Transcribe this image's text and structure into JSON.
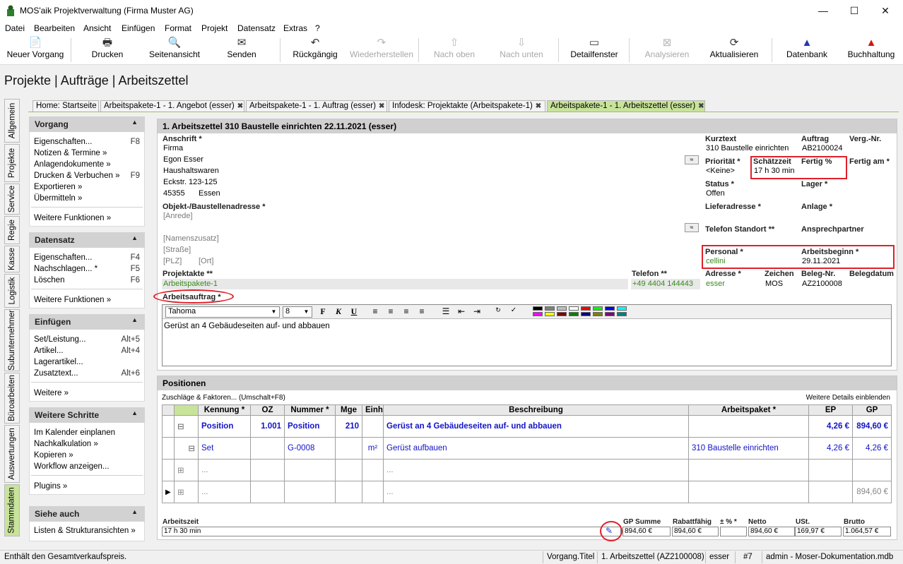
{
  "window": {
    "title": "MOS'aik Projektverwaltung (Firma Muster AG)",
    "minimize": "—",
    "maximize": "☐",
    "close": "✕"
  },
  "menu": [
    "Datei",
    "Bearbeiten",
    "Ansicht",
    "Einfügen",
    "Format",
    "Projekt",
    "Datensatz",
    "Extras",
    "?"
  ],
  "toolbar": [
    {
      "label": "Neuer Vorgang",
      "icon": "📄"
    },
    {
      "label": "Drucken",
      "icon": "🖶"
    },
    {
      "label": "Seitenansicht",
      "icon": "🔍"
    },
    {
      "label": "Senden",
      "icon": "✉"
    },
    {
      "label": "Rückgängig",
      "icon": "↶"
    },
    {
      "label": "Wiederherstellen",
      "icon": "↷"
    },
    {
      "label": "Nach oben",
      "icon": "⇧"
    },
    {
      "label": "Nach unten",
      "icon": "⇩"
    },
    {
      "label": "Detailfenster",
      "icon": "▭"
    },
    {
      "label": "Analysieren",
      "icon": "⊠"
    },
    {
      "label": "Aktualisieren",
      "icon": "⟳"
    },
    {
      "label": "Datenbank",
      "icon": "▲"
    },
    {
      "label": "Buchhaltung",
      "icon": "▲"
    }
  ],
  "breadcrumb": "Projekte | Aufträge | Arbeitszettel",
  "side_tabs": [
    "Allgemein",
    "Projekte",
    "Service",
    "Regie",
    "Kasse",
    "Logistik",
    "Subunternehmer",
    "Büroarbeiten",
    "Auswertungen",
    "Stammdaten"
  ],
  "doc_tabs": [
    "Home: Startseite",
    "Arbeitspakete-1 - 1. Angebot (esser)",
    "Arbeitspakete-1 - 1. Auftrag (esser)",
    "Infodesk: Projektakte (Arbeitspakete-1)",
    "Arbeitspakete-1 - 1. Arbeitszettel (esser)"
  ],
  "tab_close": "✖",
  "left_panel": {
    "vorgang": {
      "title": "Vorgang",
      "items": [
        {
          "label": "Eigenschaften...",
          "key": "F8"
        },
        {
          "label": "Notizen & Termine »",
          "key": ""
        },
        {
          "label": "Anlagendokumente »",
          "key": ""
        },
        {
          "label": "Drucken & Verbuchen »",
          "key": "F9"
        },
        {
          "label": "Exportieren »",
          "key": ""
        },
        {
          "label": "Übermitteln »",
          "key": ""
        }
      ],
      "more": "Weitere Funktionen »"
    },
    "datensatz": {
      "title": "Datensatz",
      "items": [
        {
          "label": "Eigenschaften...",
          "key": "F4"
        },
        {
          "label": "Nachschlagen... *",
          "key": "F5"
        },
        {
          "label": "Löschen",
          "key": "F6"
        }
      ],
      "more": "Weitere Funktionen »"
    },
    "einfuegen": {
      "title": "Einfügen",
      "items": [
        {
          "label": "Set/Leistung...",
          "key": "Alt+5"
        },
        {
          "label": "Artikel...",
          "key": "Alt+4"
        },
        {
          "label": "Lagerartikel...",
          "key": ""
        },
        {
          "label": "Zusatztext...",
          "key": "Alt+6"
        }
      ],
      "more": "Weitere »"
    },
    "schritte": {
      "title": "Weitere Schritte",
      "items": [
        {
          "label": "Im Kalender einplanen",
          "key": ""
        },
        {
          "label": "Nachkalkulation »",
          "key": ""
        },
        {
          "label": "Kopieren »",
          "key": ""
        },
        {
          "label": "Workflow anzeigen...",
          "key": ""
        }
      ],
      "more": "Plugins »"
    },
    "siehe": {
      "title": "Siehe auch",
      "items": [
        {
          "label": "Listen & Strukturansichten »",
          "key": ""
        }
      ]
    }
  },
  "form": {
    "header": "1. Arbeitszettel 310 Baustelle einrichten 22.11.2021 (esser)",
    "anschrift_label": "Anschrift *",
    "anschrift": [
      "Firma",
      "Egon Esser",
      "Haushaltswaren",
      "Eckstr. 123-125"
    ],
    "plz": "45355",
    "ort": "Essen",
    "objekt_label": "Objekt-/Baustellenadresse *",
    "objekt_placeholders": {
      "anrede": "[Anrede]",
      "namenszusatz": "[Namenszusatz]",
      "strasse": "[Straße]",
      "plz": "[PLZ]",
      "ort": "[Ort]"
    },
    "projektakte_label": "Projektakte **",
    "projektakte": "Arbeitspakete-1",
    "telefon_label": "Telefon **",
    "telefon": "+49 4404 144443",
    "adresse_label": "Adresse *",
    "adresse": "esser",
    "zeichen_label": "Zeichen",
    "zeichen": "MOS",
    "belegnr_label": "Beleg-Nr.",
    "belegnr": "AZ2100008",
    "belegdatum_label": "Belegdatum",
    "belegdatum": "",
    "kurztext_label": "Kurztext",
    "kurztext": "310 Baustelle einrichten",
    "auftrag_label": "Auftrag",
    "auftrag": "AB2100024",
    "vergnr_label": "Verg.-Nr.",
    "vergnr": "",
    "prioritaet_label": "Priorität *",
    "prioritaet": "<Keine>",
    "schaetzzeit_label": "Schätzzeit",
    "schaetzzeit": "17 h 30 min",
    "fertig_label": "Fertig %",
    "fertig": "",
    "fertigam_label": "Fertig am *",
    "fertigam": "",
    "status_label": "Status *",
    "status": "Offen",
    "lager_label": "Lager *",
    "lager": "",
    "lieferadresse_label": "Lieferadresse *",
    "lieferadresse": "",
    "anlage_label": "Anlage *",
    "anlage": "",
    "telstandort_label": "Telefon Standort **",
    "telstandort": "",
    "ansprech_label": "Ansprechpartner",
    "ansprech": "",
    "personal_label": "Personal *",
    "personal": "cellini",
    "arbeitsbeginn_label": "Arbeitsbeginn *",
    "arbeitsbeginn": "29.11.2021",
    "arbeitsauftrag_label": "Arbeitsauftrag *",
    "editor_font": "Tahoma",
    "editor_size": "8",
    "editor_text": "Gerüst an 4 Gebäudeseiten auf- und abbauen",
    "fmt_buttons": [
      "F",
      "K",
      "U"
    ],
    "swatch_colors": [
      "#000000",
      "#808080",
      "#c0c0c0",
      "#ffffff",
      "#ff0000",
      "#00ff00",
      "#0000ff",
      "#00ffff",
      "#ff00ff",
      "#ffff00",
      "#800000",
      "#008000",
      "#000080",
      "#808000",
      "#800080",
      "#008080"
    ]
  },
  "positions": {
    "title": "Positionen",
    "zuschlaege": "Zuschläge & Faktoren... (Umschalt+F8)",
    "details": "Weitere Details einblenden",
    "columns": [
      "Kennung *",
      "OZ",
      "Nummer *",
      "Mge",
      "Einh",
      "Beschreibung",
      "Arbeitspaket *",
      "EP",
      "GP"
    ],
    "rows": [
      {
        "kennung": "Position",
        "oz": "1.001",
        "nummer": "Position",
        "mge": "210",
        "einh": "",
        "beschreibung": "Gerüst an 4 Gebäudeseiten auf- und abbauen",
        "arbeitspaket": "",
        "ep": "4,26 €",
        "gp": "894,60 €"
      },
      {
        "kennung": "Set",
        "oz": "",
        "nummer": "G-0008",
        "mge": "",
        "einh": "m²",
        "beschreibung": "Gerüst aufbauen",
        "arbeitspaket": "310 Baustelle einrichten",
        "ep": "4,26 €",
        "gp": "4,26 €"
      },
      {
        "kennung": "...",
        "oz": "",
        "nummer": "",
        "mge": "",
        "einh": "",
        "beschreibung": "...",
        "arbeitspaket": "",
        "ep": "",
        "gp": ""
      },
      {
        "kennung": "...",
        "oz": "",
        "nummer": "",
        "mge": "",
        "einh": "",
        "beschreibung": "...",
        "arbeitspaket": "",
        "ep": "",
        "gp": "894,60 €"
      }
    ]
  },
  "summary": {
    "arbeitszeit_label": "Arbeitszeit",
    "arbeitszeit": "17 h 30 min",
    "gpsumme_label": "GP Summe",
    "gpsumme": "894,60 €",
    "rabatt_label": "Rabattfähig",
    "rabatt": "894,60 €",
    "pm_label": "± % *",
    "pm": "",
    "netto_label": "Netto",
    "netto": "894,60 €",
    "ust_label": "USt.",
    "ust": "169,97 €",
    "brutto_label": "Brutto",
    "brutto": "1.064,57 €"
  },
  "status_bar": {
    "message": "Enthält den Gesamtverkaufspreis.",
    "field": "Vorgang.Titel",
    "doc": "1. Arbeitszettel (AZ2100008)",
    "user": "esser",
    "num": "#7",
    "db": "admin - Moser-Dokumentation.mdb"
  }
}
